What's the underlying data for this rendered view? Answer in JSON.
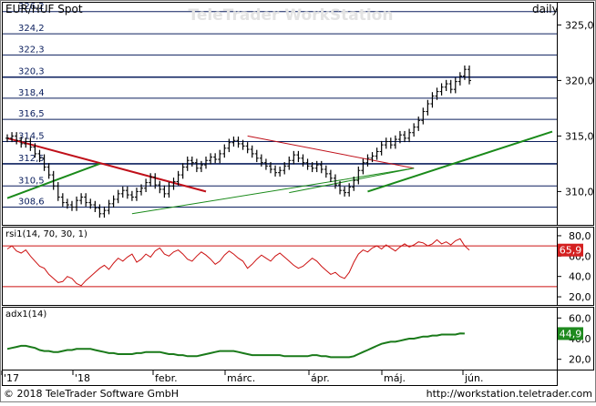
{
  "header": {
    "instrument": "EUR/HUF Spot",
    "watermark": "TeleTrader WorkStation",
    "interval": "daily"
  },
  "footer": {
    "copyright": "© 2018 TeleTrader Software GmbH",
    "url": "http://workstation.teletrader.com"
  },
  "colors": {
    "price_bars": "#000000",
    "fib_lines": "#0b1f5e",
    "trend_red": "#c0101a",
    "trend_green": "#1a8a1a",
    "rsi_line": "#cc1111",
    "adx_line": "#1a7a1a",
    "rsi_badge": "#d42020",
    "adx_badge": "#1f8a1f"
  },
  "chart_data": [
    {
      "panel": "price",
      "type": "ohlc",
      "title": "EUR/HUF Spot",
      "interval": "daily",
      "y_axis_ticks": [
        "310,0",
        "315,0",
        "320,0",
        "325,0"
      ],
      "ylim": [
        307.0,
        327.0
      ],
      "x_axis_labels": [
        "'17",
        "'18",
        "febr.",
        "márc.",
        "ápr.",
        "máj.",
        "jún."
      ],
      "fib_levels": [
        {
          "value": 326.2,
          "label": "326,2"
        },
        {
          "value": 324.2,
          "label": "324,2"
        },
        {
          "value": 322.3,
          "label": "322,3"
        },
        {
          "value": 320.3,
          "label": "320,3"
        },
        {
          "value": 318.4,
          "label": "318,4"
        },
        {
          "value": 316.5,
          "label": "316,5"
        },
        {
          "value": 314.5,
          "label": "314,5"
        },
        {
          "value": 312.5,
          "label": "312,5"
        },
        {
          "value": 310.5,
          "label": "310,5"
        },
        {
          "value": 308.6,
          "label": "308,6"
        }
      ],
      "closes": [
        314.8,
        315.0,
        314.6,
        314.3,
        314.5,
        314.0,
        313.4,
        313.0,
        312.2,
        311.5,
        310.5,
        309.5,
        309.0,
        308.8,
        308.6,
        309.2,
        309.5,
        309.0,
        308.8,
        308.5,
        308.0,
        308.3,
        308.9,
        309.3,
        309.8,
        310.1,
        309.7,
        309.5,
        310.0,
        310.3,
        310.8,
        311.3,
        310.6,
        310.2,
        309.8,
        310.5,
        310.9,
        311.5,
        312.2,
        312.8,
        312.6,
        312.1,
        312.4,
        312.8,
        313.1,
        312.9,
        313.4,
        313.9,
        314.4,
        314.6,
        314.3,
        314.1,
        313.8,
        313.4,
        313.0,
        312.6,
        312.3,
        312.0,
        311.7,
        311.9,
        312.3,
        312.8,
        313.3,
        313.0,
        312.6,
        312.3,
        312.1,
        312.4,
        312.0,
        311.6,
        311.2,
        310.6,
        310.1,
        309.9,
        310.4,
        311.0,
        311.9,
        312.6,
        313.0,
        313.2,
        313.6,
        314.2,
        314.5,
        314.2,
        314.7,
        315.1,
        314.8,
        315.3,
        315.8,
        316.4,
        317.2,
        317.9,
        318.6,
        319.0,
        319.4,
        319.7,
        319.2,
        319.9,
        320.4,
        321.0,
        320.0
      ],
      "trend_lines": [
        {
          "color": "red",
          "from": 314.8,
          "to": 310.0
        },
        {
          "color": "red",
          "from": 315.0,
          "to": 312.1
        },
        {
          "color": "green",
          "from": 308.0,
          "to": 312.1
        },
        {
          "color": "green",
          "from": 310.0,
          "to": 315.4
        },
        {
          "color": "green",
          "from": 309.9,
          "to": 312.1
        },
        {
          "color": "green",
          "from": 309.4,
          "to": 312.5
        }
      ]
    },
    {
      "panel": "rsi",
      "type": "line",
      "title": "rsi1(14, 70, 30, 1)",
      "y_axis_ticks": [
        "20,0",
        "40,0",
        "60,0",
        "80,0"
      ],
      "ylim": [
        12,
        88
      ],
      "levels": [
        70,
        30
      ],
      "last_value": "65,9",
      "values": [
        67,
        70,
        65,
        63,
        66,
        60,
        55,
        50,
        48,
        42,
        38,
        34,
        35,
        40,
        38,
        33,
        31,
        36,
        40,
        44,
        48,
        51,
        47,
        53,
        58,
        55,
        59,
        62,
        54,
        57,
        62,
        59,
        65,
        68,
        62,
        60,
        64,
        66,
        62,
        57,
        55,
        60,
        64,
        61,
        57,
        52,
        55,
        61,
        65,
        62,
        58,
        55,
        48,
        52,
        57,
        61,
        58,
        55,
        60,
        63,
        59,
        55,
        51,
        48,
        50,
        54,
        58,
        55,
        50,
        46,
        42,
        44,
        40,
        38,
        44,
        54,
        62,
        66,
        64,
        68,
        70,
        67,
        71,
        68,
        65,
        69,
        72,
        69,
        71,
        74,
        73,
        70,
        72,
        76,
        72,
        74,
        71,
        75,
        77,
        70,
        65.9
      ]
    },
    {
      "panel": "adx",
      "type": "line",
      "title": "adx1(14)",
      "y_axis_ticks": [
        "20,0",
        "40,0",
        "60,0"
      ],
      "ylim": [
        10,
        70
      ],
      "last_value": "44,9",
      "values": [
        30,
        31,
        32,
        33,
        33,
        32,
        31,
        29,
        28,
        28,
        27,
        27,
        28,
        29,
        29,
        30,
        30,
        30,
        30,
        29,
        28,
        27,
        26,
        26,
        25,
        25,
        25,
        25,
        26,
        26,
        27,
        27,
        27,
        27,
        26,
        25,
        25,
        24,
        24,
        23,
        23,
        23,
        24,
        25,
        26,
        27,
        28,
        28,
        28,
        28,
        27,
        26,
        25,
        24,
        24,
        24,
        24,
        24,
        24,
        24,
        23,
        23,
        23,
        23,
        23,
        23,
        24,
        24,
        23,
        23,
        22,
        22,
        22,
        22,
        22,
        23,
        25,
        27,
        29,
        31,
        33,
        35,
        36,
        37,
        37,
        38,
        39,
        40,
        40,
        41,
        42,
        42,
        43,
        43,
        44,
        44,
        44,
        44,
        45,
        44.9
      ]
    }
  ]
}
